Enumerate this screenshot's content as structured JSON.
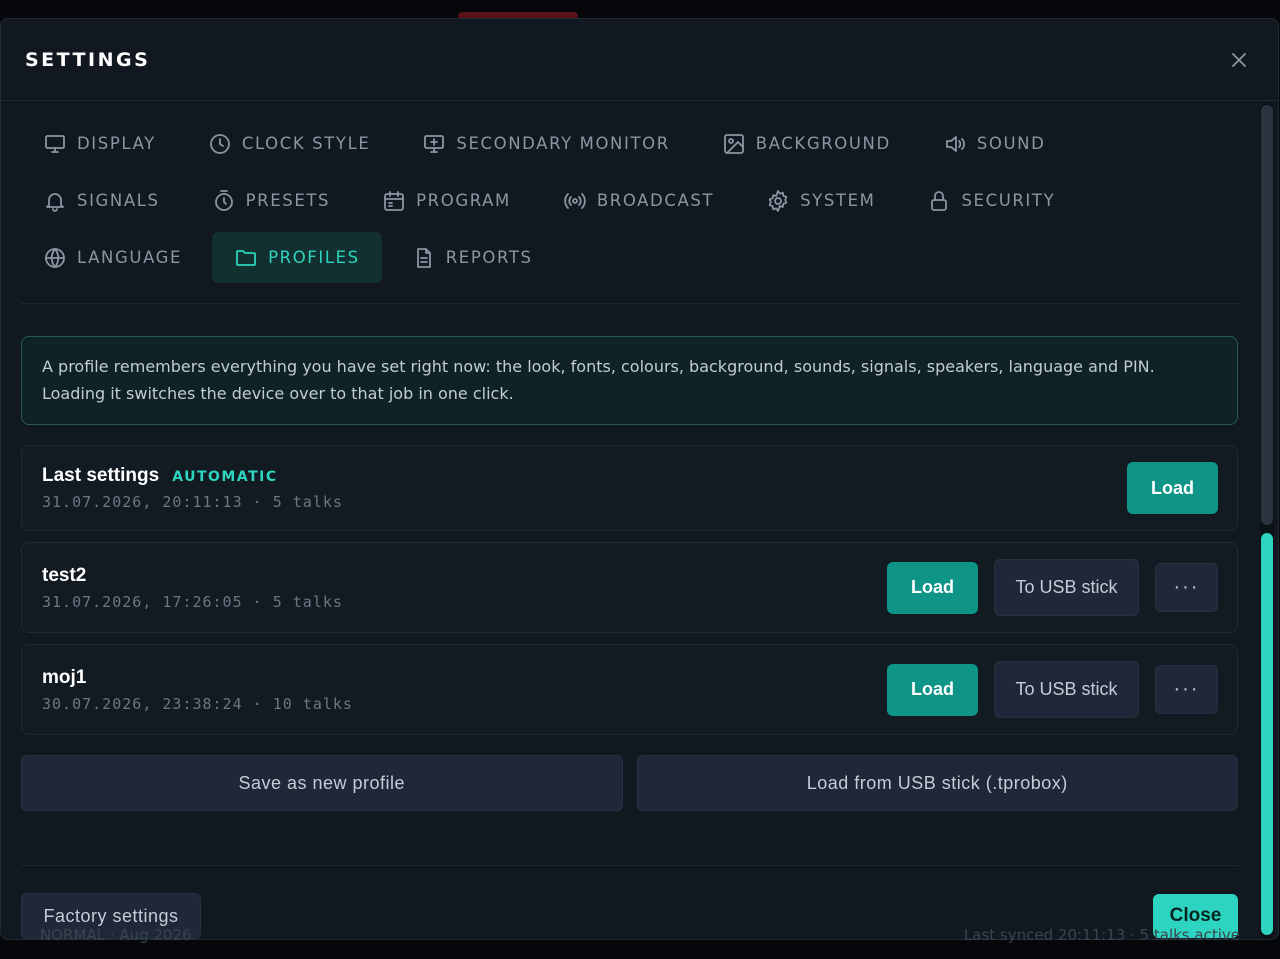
{
  "backdrop": {
    "footer_left": "NORMAL · Aug 2026",
    "footer_right": "Last synced 20:11:13 · 5 talks active"
  },
  "dialog": {
    "title": "SETTINGS",
    "close_icon": "close-icon"
  },
  "tabs": [
    {
      "label": "DISPLAY",
      "icon": "monitor-icon",
      "active": false
    },
    {
      "label": "CLOCK STYLE",
      "icon": "clock-icon",
      "active": false
    },
    {
      "label": "SECONDARY MONITOR",
      "icon": "monitor-plus-icon",
      "active": false
    },
    {
      "label": "BACKGROUND",
      "icon": "image-icon",
      "active": false
    },
    {
      "label": "SOUND",
      "icon": "speaker-icon",
      "active": false
    },
    {
      "label": "SIGNALS",
      "icon": "bell-icon",
      "active": false
    },
    {
      "label": "PRESETS",
      "icon": "timer-icon",
      "active": false
    },
    {
      "label": "PROGRAM",
      "icon": "calendar-icon",
      "active": false
    },
    {
      "label": "BROADCAST",
      "icon": "broadcast-icon",
      "active": false
    },
    {
      "label": "SYSTEM",
      "icon": "gear-icon",
      "active": false
    },
    {
      "label": "SECURITY",
      "icon": "lock-icon",
      "active": false
    },
    {
      "label": "LANGUAGE",
      "icon": "globe-icon",
      "active": false
    },
    {
      "label": "PROFILES",
      "icon": "folder-icon",
      "active": true
    },
    {
      "label": "REPORTS",
      "icon": "document-icon",
      "active": false
    }
  ],
  "info": {
    "text": "A profile remembers everything you have set right now: the look, fonts, colours, background, sounds, signals, speakers, language and PIN. Loading it switches the device over to that job in one click."
  },
  "profiles": [
    {
      "name": "Last settings",
      "badge": "AUTOMATIC",
      "meta": "31.07.2026, 20:11:13 · 5 talks",
      "load_label": "Load"
    },
    {
      "name": "test2",
      "meta": "31.07.2026, 17:26:05 · 5 talks",
      "load_label": "Load",
      "usb_label": "To USB stick",
      "more_label": "···"
    },
    {
      "name": "moj1",
      "meta": "30.07.2026, 23:38:24 · 10 talks",
      "load_label": "Load",
      "usb_label": "To USB stick",
      "more_label": "···"
    }
  ],
  "actions": {
    "save_new": "Save as new profile",
    "load_usb": "Load from USB stick (.tprobox)"
  },
  "footer": {
    "factory": "Factory settings",
    "close": "Close"
  },
  "colors": {
    "accent": "#2dd4bf",
    "primary_button": "#0f9488",
    "modal_bg": "#111820"
  }
}
